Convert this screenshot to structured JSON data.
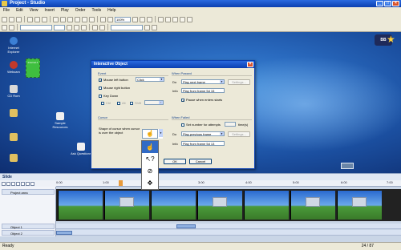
{
  "window": {
    "title": "Project - Studio"
  },
  "menu": [
    "File",
    "Edit",
    "View",
    "Insert",
    "Play",
    "Order",
    "Tools",
    "Help"
  ],
  "toolbar": {
    "zoom": "100%"
  },
  "desktop": {
    "icons": [
      {
        "label": "Internet Explorer",
        "color": "#3b7fd4"
      },
      {
        "label": "Webcam",
        "color": "#c0392b"
      },
      {
        "label": "CD Rom",
        "color": "#d8d8d8"
      },
      {
        "label": "",
        "color": "#e0c060"
      },
      {
        "label": "",
        "color": "#e0c060"
      },
      {
        "label": "",
        "color": "#e0c060"
      }
    ],
    "mid_icons": [
      {
        "label": "Sample Resources"
      },
      {
        "label": "Ask Questions"
      }
    ],
    "green_box_label": "Internal-1",
    "logo_text": "BB",
    "accent": "#3fbf3f"
  },
  "dialog": {
    "title": "Interactive Object",
    "event_group": "Event",
    "mouse_left": {
      "label": "Mouse left button",
      "checked": true,
      "action": "Click"
    },
    "mouse_right": {
      "label": "Mouse right button",
      "checked": false
    },
    "key_down": {
      "label": "Key Down",
      "checked": false,
      "ctrl": "Ctrl",
      "alt": "Alt",
      "shift": "Shift"
    },
    "cursor_group": "Cursor",
    "cursor_label": "Shape of cursor when cursor is over the object",
    "when_passed": {
      "title": "When Passed",
      "do_label": "Do",
      "do_value": "Play next frame",
      "settings": "Settings...",
      "info_label": "Info",
      "info_value": "Play from frame 5d 15",
      "pause_label": "Pause when enters starts",
      "pause_checked": true
    },
    "when_failed": {
      "title": "When Failed",
      "set_attempts_label": "Set number for attempts",
      "times_label": "time(s)",
      "do_label": "Do",
      "do_value": "Play previous frame",
      "settings": "Settings...",
      "info_label": "Info",
      "info_value": "Play from frame 5d 13"
    },
    "ok": "OK",
    "cancel": "Cancel",
    "cursor_options": [
      "☝",
      "↖?",
      "⊘",
      "✥"
    ]
  },
  "timeline": {
    "header": "Slide",
    "ticks": [
      "0:00",
      "1:00",
      "2:00",
      "3:00",
      "4:00",
      "5:00",
      "6:00",
      "7:00"
    ],
    "tracks": [
      "Project area",
      "Object 1",
      "Object 2"
    ]
  },
  "status": {
    "left": "Ready",
    "pages": "24 / 87"
  }
}
